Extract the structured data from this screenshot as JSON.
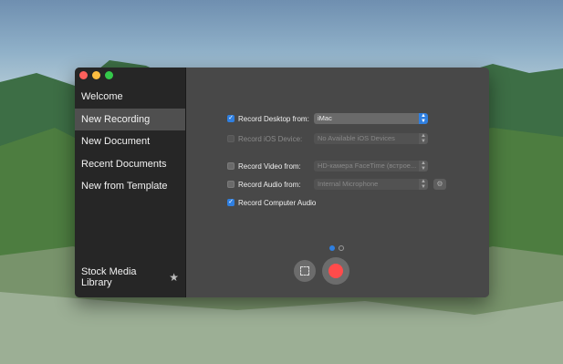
{
  "sidebar": {
    "items": [
      {
        "label": "Welcome",
        "active": false
      },
      {
        "label": "New Recording",
        "active": true
      },
      {
        "label": "New Document",
        "active": false
      },
      {
        "label": "Recent Documents",
        "active": false
      },
      {
        "label": "New from Template",
        "active": false
      }
    ],
    "footer_label": "Stock Media Library",
    "footer_icon": "star-icon"
  },
  "options": {
    "desktop": {
      "label": "Record Desktop from:",
      "checked": true,
      "enabled": true,
      "value": "iMac"
    },
    "ios": {
      "label": "Record iOS Device:",
      "checked": false,
      "enabled": false,
      "value": "No Available iOS Devices"
    },
    "video": {
      "label": "Record Video from:",
      "checked": false,
      "enabled": true,
      "value": "HD-камера FaceTime (встрое..."
    },
    "audio": {
      "label": "Record Audio from:",
      "checked": false,
      "enabled": true,
      "value": "Internal Microphone"
    },
    "computer_audio": {
      "label": "Record Computer Audio",
      "checked": true,
      "enabled": true
    }
  },
  "pager": {
    "pages": 2,
    "current": 1
  },
  "controls": {
    "crop_icon": "crop-selection-icon",
    "record_icon": "record-icon"
  },
  "colors": {
    "accent": "#2f7fe0",
    "record": "#ff4b4b",
    "sidebar_bg": "#262626",
    "main_bg": "#484848"
  }
}
